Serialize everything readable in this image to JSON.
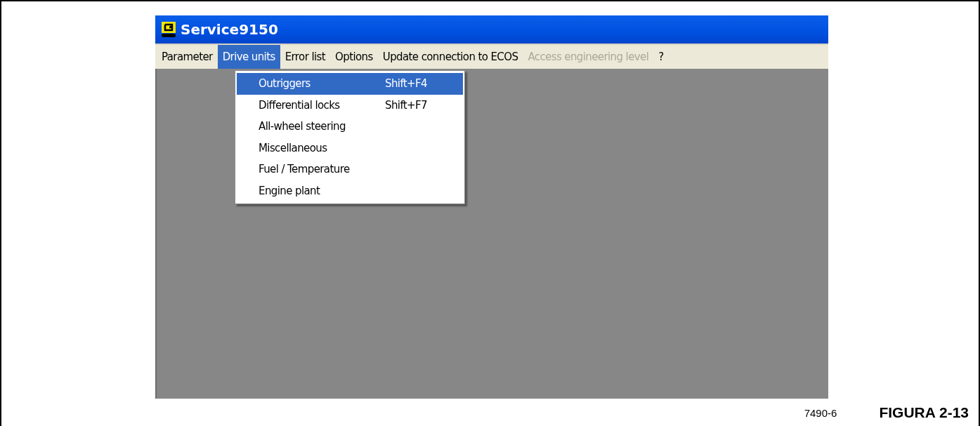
{
  "window": {
    "title": "Service9150"
  },
  "menu_bar": [
    {
      "label": "Parameter",
      "selected": false,
      "disabled": false
    },
    {
      "label": "Drive units",
      "selected": true,
      "disabled": false
    },
    {
      "label": "Error list",
      "selected": false,
      "disabled": false
    },
    {
      "label": "Options",
      "selected": false,
      "disabled": false
    },
    {
      "label": "Update connection to ECOS",
      "selected": false,
      "disabled": false
    },
    {
      "label": "Access engineering level",
      "selected": false,
      "disabled": true
    },
    {
      "label": "?",
      "selected": false,
      "disabled": false
    }
  ],
  "dropdown": [
    {
      "label": "Outriggers",
      "shortcut": "Shift+F4",
      "selected": true
    },
    {
      "label": "Differential locks",
      "shortcut": "Shift+F7",
      "selected": false
    },
    {
      "label": "All-wheel steering",
      "selected": false
    },
    {
      "label": "Miscellaneous",
      "selected": false
    },
    {
      "label": "Fuel / Temperature",
      "selected": false
    },
    {
      "label": "Engine plant",
      "selected": false
    }
  ],
  "figure": {
    "code": "7490-6",
    "caption": "FIGURA 2-13"
  }
}
